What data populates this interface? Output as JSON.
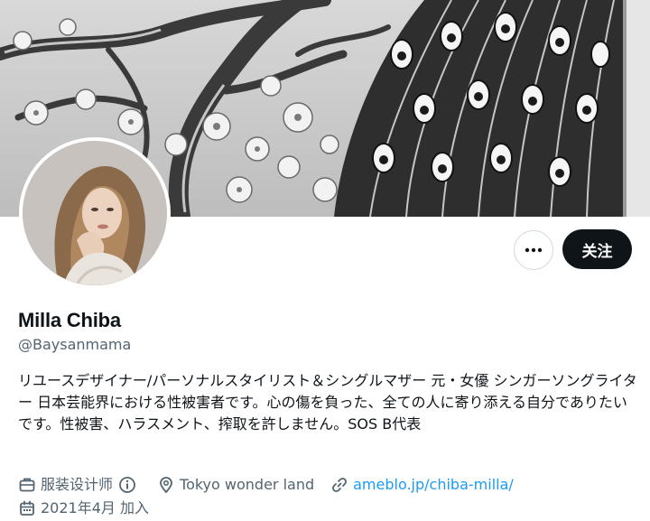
{
  "profile": {
    "display_name": "Milla Chiba",
    "handle": "@Baysanmama",
    "bio": "リユースデザイナー/パーソナルスタイリスト＆シングルマザー 元・女優 シンガーソングライター 日本芸能界における性被害者です。心の傷を負った、全ての人に寄り添える自分でありたいです。性被害、ハラスメント、搾取を許しません。SOS B代表",
    "profession": "服装设计师",
    "location": "Tokyo wonder land",
    "website": "ameblo.jp/chiba-milla/",
    "joined": "2021年4月 加入"
  },
  "actions": {
    "follow_label": "关注",
    "more_icon": "ellipsis-icon"
  },
  "icons": {
    "profession": "briefcase-icon",
    "info": "info-icon",
    "location": "location-pin-icon",
    "website": "link-icon",
    "joined": "calendar-icon"
  },
  "colors": {
    "follow_bg": "#0f1419",
    "link": "#1d9bf0",
    "secondary_text": "#536471"
  }
}
